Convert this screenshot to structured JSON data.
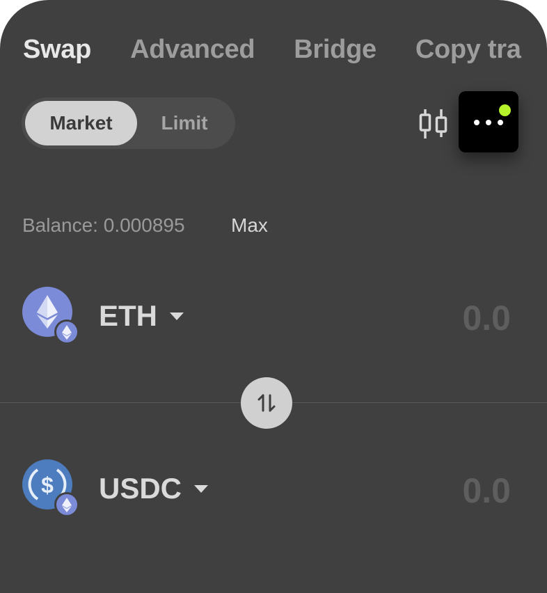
{
  "tabs": [
    {
      "label": "Swap",
      "active": true
    },
    {
      "label": "Advanced",
      "active": false
    },
    {
      "label": "Bridge",
      "active": false
    },
    {
      "label": "Copy tra",
      "active": false
    }
  ],
  "order_type": {
    "market_label": "Market",
    "limit_label": "Limit",
    "selected": "Market"
  },
  "toolbar": {
    "chart_icon": "candlestick-chart-icon",
    "more_icon": "more-dots-icon",
    "notification_color": "#b6f32a"
  },
  "balance": {
    "label": "Balance: 0.000895",
    "max_label": "Max"
  },
  "from_token": {
    "symbol": "ETH",
    "amount_placeholder": "0.0",
    "icon": "ethereum-icon",
    "network_icon": "ethereum-network-icon",
    "color": "#7f8fe0"
  },
  "to_token": {
    "symbol": "USDC",
    "amount_placeholder": "0.0",
    "icon": "usdc-icon",
    "network_icon": "ethereum-network-icon",
    "color": "#5a87c6"
  },
  "swap_direction_icon": "swap-arrows-icon"
}
